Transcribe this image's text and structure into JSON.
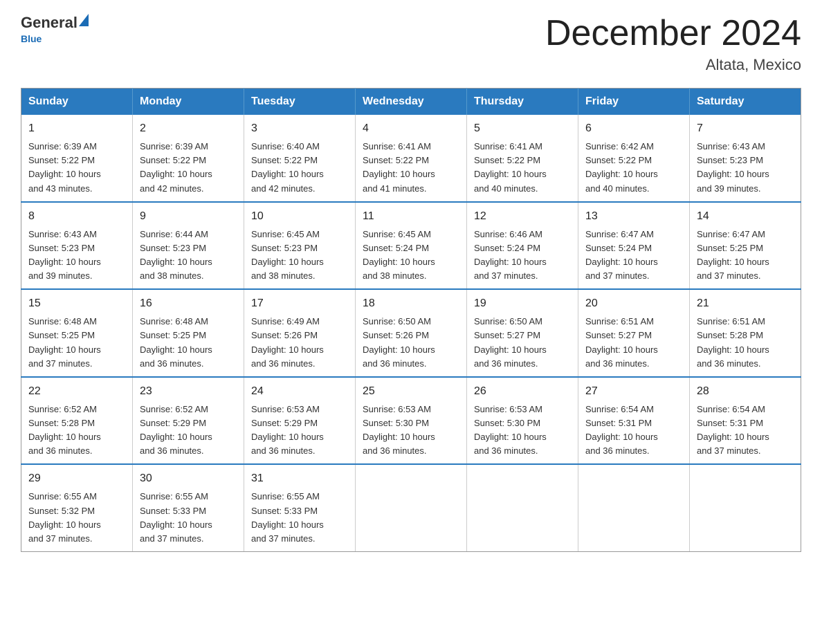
{
  "logo": {
    "general": "General",
    "triangle": "",
    "blue": "Blue"
  },
  "header": {
    "month_title": "December 2024",
    "location": "Altata, Mexico"
  },
  "weekdays": [
    "Sunday",
    "Monday",
    "Tuesday",
    "Wednesday",
    "Thursday",
    "Friday",
    "Saturday"
  ],
  "weeks": [
    [
      {
        "day": "1",
        "sunrise": "6:39 AM",
        "sunset": "5:22 PM",
        "daylight": "10 hours and 43 minutes."
      },
      {
        "day": "2",
        "sunrise": "6:39 AM",
        "sunset": "5:22 PM",
        "daylight": "10 hours and 42 minutes."
      },
      {
        "day": "3",
        "sunrise": "6:40 AM",
        "sunset": "5:22 PM",
        "daylight": "10 hours and 42 minutes."
      },
      {
        "day": "4",
        "sunrise": "6:41 AM",
        "sunset": "5:22 PM",
        "daylight": "10 hours and 41 minutes."
      },
      {
        "day": "5",
        "sunrise": "6:41 AM",
        "sunset": "5:22 PM",
        "daylight": "10 hours and 40 minutes."
      },
      {
        "day": "6",
        "sunrise": "6:42 AM",
        "sunset": "5:22 PM",
        "daylight": "10 hours and 40 minutes."
      },
      {
        "day": "7",
        "sunrise": "6:43 AM",
        "sunset": "5:23 PM",
        "daylight": "10 hours and 39 minutes."
      }
    ],
    [
      {
        "day": "8",
        "sunrise": "6:43 AM",
        "sunset": "5:23 PM",
        "daylight": "10 hours and 39 minutes."
      },
      {
        "day": "9",
        "sunrise": "6:44 AM",
        "sunset": "5:23 PM",
        "daylight": "10 hours and 38 minutes."
      },
      {
        "day": "10",
        "sunrise": "6:45 AM",
        "sunset": "5:23 PM",
        "daylight": "10 hours and 38 minutes."
      },
      {
        "day": "11",
        "sunrise": "6:45 AM",
        "sunset": "5:24 PM",
        "daylight": "10 hours and 38 minutes."
      },
      {
        "day": "12",
        "sunrise": "6:46 AM",
        "sunset": "5:24 PM",
        "daylight": "10 hours and 37 minutes."
      },
      {
        "day": "13",
        "sunrise": "6:47 AM",
        "sunset": "5:24 PM",
        "daylight": "10 hours and 37 minutes."
      },
      {
        "day": "14",
        "sunrise": "6:47 AM",
        "sunset": "5:25 PM",
        "daylight": "10 hours and 37 minutes."
      }
    ],
    [
      {
        "day": "15",
        "sunrise": "6:48 AM",
        "sunset": "5:25 PM",
        "daylight": "10 hours and 37 minutes."
      },
      {
        "day": "16",
        "sunrise": "6:48 AM",
        "sunset": "5:25 PM",
        "daylight": "10 hours and 36 minutes."
      },
      {
        "day": "17",
        "sunrise": "6:49 AM",
        "sunset": "5:26 PM",
        "daylight": "10 hours and 36 minutes."
      },
      {
        "day": "18",
        "sunrise": "6:50 AM",
        "sunset": "5:26 PM",
        "daylight": "10 hours and 36 minutes."
      },
      {
        "day": "19",
        "sunrise": "6:50 AM",
        "sunset": "5:27 PM",
        "daylight": "10 hours and 36 minutes."
      },
      {
        "day": "20",
        "sunrise": "6:51 AM",
        "sunset": "5:27 PM",
        "daylight": "10 hours and 36 minutes."
      },
      {
        "day": "21",
        "sunrise": "6:51 AM",
        "sunset": "5:28 PM",
        "daylight": "10 hours and 36 minutes."
      }
    ],
    [
      {
        "day": "22",
        "sunrise": "6:52 AM",
        "sunset": "5:28 PM",
        "daylight": "10 hours and 36 minutes."
      },
      {
        "day": "23",
        "sunrise": "6:52 AM",
        "sunset": "5:29 PM",
        "daylight": "10 hours and 36 minutes."
      },
      {
        "day": "24",
        "sunrise": "6:53 AM",
        "sunset": "5:29 PM",
        "daylight": "10 hours and 36 minutes."
      },
      {
        "day": "25",
        "sunrise": "6:53 AM",
        "sunset": "5:30 PM",
        "daylight": "10 hours and 36 minutes."
      },
      {
        "day": "26",
        "sunrise": "6:53 AM",
        "sunset": "5:30 PM",
        "daylight": "10 hours and 36 minutes."
      },
      {
        "day": "27",
        "sunrise": "6:54 AM",
        "sunset": "5:31 PM",
        "daylight": "10 hours and 36 minutes."
      },
      {
        "day": "28",
        "sunrise": "6:54 AM",
        "sunset": "5:31 PM",
        "daylight": "10 hours and 37 minutes."
      }
    ],
    [
      {
        "day": "29",
        "sunrise": "6:55 AM",
        "sunset": "5:32 PM",
        "daylight": "10 hours and 37 minutes."
      },
      {
        "day": "30",
        "sunrise": "6:55 AM",
        "sunset": "5:33 PM",
        "daylight": "10 hours and 37 minutes."
      },
      {
        "day": "31",
        "sunrise": "6:55 AM",
        "sunset": "5:33 PM",
        "daylight": "10 hours and 37 minutes."
      },
      null,
      null,
      null,
      null
    ]
  ],
  "labels": {
    "sunrise": "Sunrise:",
    "sunset": "Sunset:",
    "daylight": "Daylight:"
  }
}
